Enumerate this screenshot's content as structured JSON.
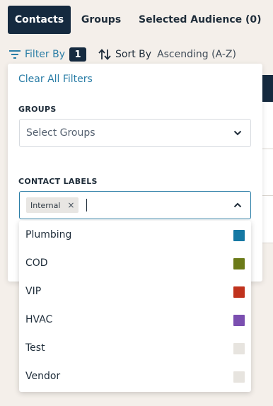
{
  "tabs": [
    {
      "label": "Contacts",
      "active": true
    },
    {
      "label": "Groups",
      "active": false
    },
    {
      "label": "Selected Audience (0)",
      "active": false
    }
  ],
  "filter_bar": {
    "filter_label": "Filter By",
    "filter_count": "1",
    "sort_label": "Sort By",
    "sort_value": "Ascending (A-Z)"
  },
  "filter_panel": {
    "clear_all": "Clear All Filters",
    "groups_heading": "GROUPS",
    "groups_placeholder": "Select Groups",
    "labels_heading": "CONTACT LABELS",
    "selected_chip": "Internal",
    "chip_remove": "×"
  },
  "label_options": [
    {
      "label": "Plumbing",
      "color": "#1578a3"
    },
    {
      "label": "COD",
      "color": "#6b7a18"
    },
    {
      "label": "VIP",
      "color": "#c0321d"
    },
    {
      "label": "HVAC",
      "color": "#7b4fb0"
    },
    {
      "label": "Test",
      "color": "#e7e4df"
    },
    {
      "label": "Vendor",
      "color": "#e7e4df"
    }
  ],
  "colors": {
    "accent": "#2a7da6",
    "navy": "#152a3f",
    "background": "#f4efea"
  }
}
